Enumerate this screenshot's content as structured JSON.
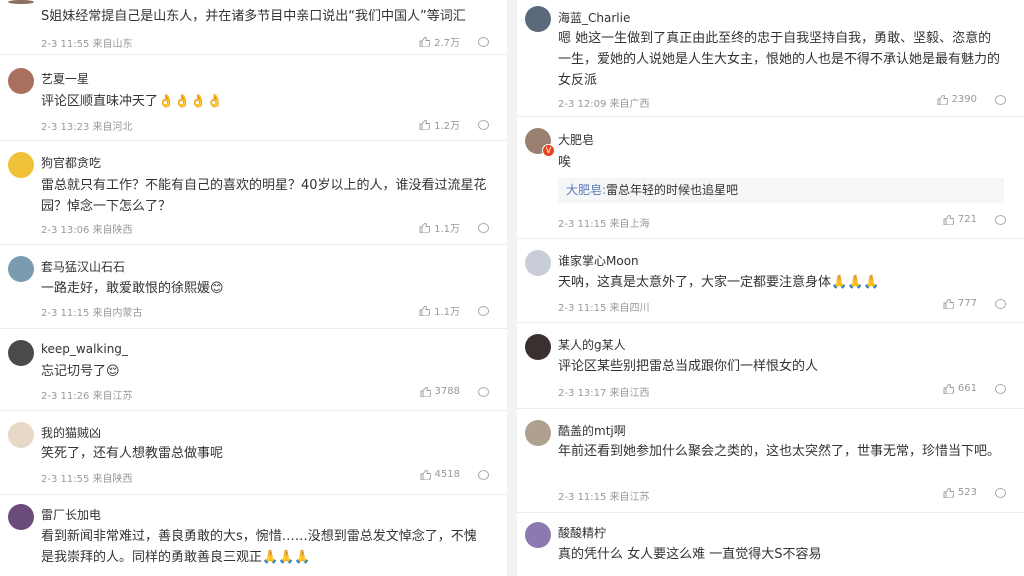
{
  "left": [
    {
      "name": "",
      "text": "S姐妹经常提自己是山东人，并在诸多节目中亲口说出“我们中国人”等词汇",
      "meta": "2-3 11:55 来自山东",
      "likes": "2.7万",
      "avatar_color": "#8a6d5a"
    },
    {
      "name": "艺夏一星",
      "text": "评论区顺直味冲天了👌👌👌👌",
      "meta": "2-3 13:23 来自河北",
      "likes": "1.2万",
      "avatar_color": "#a9705e"
    },
    {
      "name": "狗官都贪吃",
      "text": "雷总就只有工作？不能有自己的喜欢的明星？40岁以上的人，谁没看过流星花园？悼念一下怎么了？",
      "meta": "2-3 13:06 来自陕西",
      "likes": "1.1万",
      "avatar_color": "#f0c23a"
    },
    {
      "name": "套马猛汉山石石",
      "text": "一路走好，敢爱敢恨的徐熙媛😊",
      "meta": "2-3 11:15 来自内蒙古",
      "likes": "1.1万",
      "avatar_color": "#7a9bb0"
    },
    {
      "name": "keep_walking_",
      "text": "忘记切号了😌",
      "meta": "2-3 11:26 来自江苏",
      "likes": "3788",
      "avatar_color": "#4a4a4a"
    },
    {
      "name": "我的猫贼凶",
      "text": "笑死了，还有人想教雷总做事呢",
      "meta": "2-3 11:55 来自陕西",
      "likes": "4518",
      "avatar_color": "#e8d8c8"
    },
    {
      "name": "雷厂长加电",
      "text": "看到新闻非常难过，善良勇敢的大s，惋惜……没想到雷总发文悼念了，不愧是我崇拜的人。同样的勇敢善良三观正🙏🙏🙏",
      "meta": "",
      "likes": "",
      "avatar_color": "#6b4b7a"
    }
  ],
  "right": [
    {
      "name": "海蓝_Charlie",
      "text": "嗯 她这一生做到了真正由此至终的忠于自我坚持自我，勇敢、坚毅、恣意的一生，爱她的人说她是人生大女主，恨她的人也是不得不承认她是最有魅力的女反派",
      "meta": "2-3 12:09 来自广西",
      "likes": "2390",
      "avatar_color": "#5a6a7a"
    },
    {
      "name": "大肥皂",
      "text": "唉",
      "reply_name": "大肥皂:",
      "reply_text": "雷总年轻的时候也追星吧",
      "meta": "2-3 11:15 来自上海",
      "likes": "721",
      "avatar_color": "#9a8070",
      "verified": "V"
    },
    {
      "name": "谁家掌心Moon",
      "text": "天呐，这真是太意外了，大家一定都要注意身体🙏🙏🙏",
      "meta": "2-3 11:15 来自四川",
      "likes": "777",
      "avatar_color": "#c8cdd8"
    },
    {
      "name": "某人的g某人",
      "text": "评论区某些别把雷总当成跟你们一样恨女的人",
      "meta": "2-3 13:17 来自江西",
      "likes": "661",
      "avatar_color": "#3a3030"
    },
    {
      "name": "酷盖的mtj啊",
      "text": "年前还看到她参加什么聚会之类的，这也太突然了，世事无常，珍惜当下吧。",
      "meta": "2-3 11:15 来自江苏",
      "likes": "523",
      "avatar_color": "#b0a090"
    },
    {
      "name": "酸酸精柠",
      "text": "真的凭什么 女人要这么难 一直觉得大S不容易",
      "meta": "",
      "likes": "",
      "avatar_color": "#8a7ab0"
    }
  ]
}
